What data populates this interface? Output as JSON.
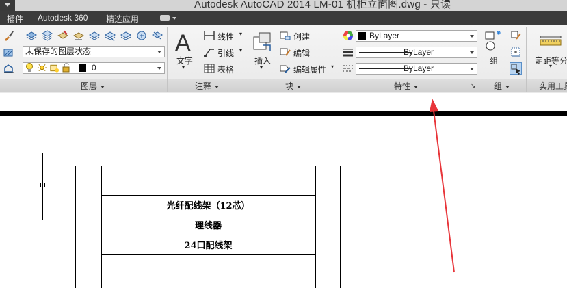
{
  "window": {
    "title": "Autodesk AutoCAD 2014    LM-01 机柜立面图.dwg - 只读"
  },
  "tabs": [
    {
      "label": "插件"
    },
    {
      "label": "Autodesk 360"
    },
    {
      "label": "精选应用"
    }
  ],
  "panels": {
    "layers": {
      "label": "图层",
      "layer_state": "未保存的图层状态",
      "current_layer": "0"
    },
    "annotation": {
      "label": "注释",
      "text_label": "文字",
      "linear_label": "线性",
      "leader_label": "引线",
      "table_label": "表格"
    },
    "block": {
      "label": "块",
      "insert_label": "插入",
      "create_label": "创建",
      "edit_label": "编辑",
      "edit_attr_label": "编辑属性"
    },
    "properties": {
      "label": "特性",
      "color_value": "ByLayer",
      "linetype_value": "ByLayer",
      "lineweight_value": "ByLayer"
    },
    "group": {
      "label": "组",
      "group_label": "组"
    },
    "utilities": {
      "label": "实用工具",
      "measure_label": "定距等分"
    }
  },
  "drawing": {
    "rows": [
      "光纤配线架（12芯）",
      "理线器",
      "24口配线架"
    ]
  }
}
